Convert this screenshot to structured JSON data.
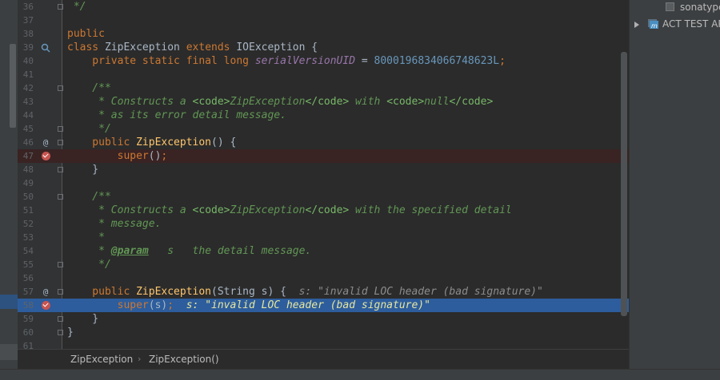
{
  "editor": {
    "lines": [
      {
        "n": "36",
        "tokens": [
          {
            "c": "cm",
            "t": " */"
          }
        ]
      },
      {
        "n": "37",
        "tokens": []
      },
      {
        "n": "38",
        "tokens": [
          {
            "c": "kw",
            "t": "public"
          }
        ]
      },
      {
        "n": "39",
        "tokens": [
          {
            "c": "kw",
            "t": "class "
          },
          {
            "c": "",
            "t": "ZipException "
          },
          {
            "c": "kw",
            "t": "extends "
          },
          {
            "c": "",
            "t": "IOException {"
          }
        ],
        "icon": "implements-icon"
      },
      {
        "n": "40",
        "tokens": [
          {
            "c": "kw",
            "t": "    private static final long "
          },
          {
            "c": "sf",
            "t": "serialVersionUID"
          },
          {
            "c": "",
            "t": " = "
          },
          {
            "c": "num",
            "t": "8000196834066748623L"
          },
          {
            "c": "kw",
            "t": ";"
          }
        ]
      },
      {
        "n": "41",
        "tokens": []
      },
      {
        "n": "42",
        "tokens": [
          {
            "c": "cm",
            "t": "    /**"
          }
        ]
      },
      {
        "n": "43",
        "tokens": [
          {
            "c": "cm",
            "t": "     * Constructs a "
          },
          {
            "c": "tag",
            "t": "<code>"
          },
          {
            "c": "cm",
            "t": "ZipException"
          },
          {
            "c": "tag",
            "t": "</code>"
          },
          {
            "c": "cm",
            "t": " with "
          },
          {
            "c": "tag",
            "t": "<code>"
          },
          {
            "c": "cm",
            "t": "null"
          },
          {
            "c": "tag",
            "t": "</code>"
          }
        ]
      },
      {
        "n": "44",
        "tokens": [
          {
            "c": "cm",
            "t": "     * as its error detail message."
          }
        ]
      },
      {
        "n": "45",
        "tokens": [
          {
            "c": "cm",
            "t": "     */"
          }
        ]
      },
      {
        "n": "46",
        "tokens": [
          {
            "c": "kw",
            "t": "    public "
          },
          {
            "c": "fn",
            "t": "ZipException"
          },
          {
            "c": "",
            "t": "() {"
          }
        ],
        "icon": "override-at-icon"
      },
      {
        "n": "47",
        "tokens": [
          {
            "c": "kw",
            "t": "        super"
          },
          {
            "c": "",
            "t": "()"
          },
          {
            "c": "kw",
            "t": ";"
          }
        ],
        "bp": true
      },
      {
        "n": "48",
        "tokens": [
          {
            "c": "",
            "t": "    }"
          }
        ]
      },
      {
        "n": "49",
        "tokens": []
      },
      {
        "n": "50",
        "tokens": [
          {
            "c": "cm",
            "t": "    /**"
          }
        ]
      },
      {
        "n": "51",
        "tokens": [
          {
            "c": "cm",
            "t": "     * Constructs a "
          },
          {
            "c": "tag",
            "t": "<code>"
          },
          {
            "c": "cm",
            "t": "ZipException"
          },
          {
            "c": "tag",
            "t": "</code>"
          },
          {
            "c": "cm",
            "t": " with the specified detail"
          }
        ]
      },
      {
        "n": "52",
        "tokens": [
          {
            "c": "cm",
            "t": "     * message."
          }
        ]
      },
      {
        "n": "53",
        "tokens": [
          {
            "c": "cm",
            "t": "     *"
          }
        ]
      },
      {
        "n": "54",
        "tokens": [
          {
            "c": "cm",
            "t": "     * "
          },
          {
            "c": "ptag",
            "t": "@param"
          },
          {
            "c": "cm",
            "t": "   s   the detail message."
          }
        ]
      },
      {
        "n": "55",
        "tokens": [
          {
            "c": "cm",
            "t": "     */"
          }
        ]
      },
      {
        "n": "56",
        "tokens": []
      },
      {
        "n": "57",
        "tokens": [
          {
            "c": "kw",
            "t": "    public "
          },
          {
            "c": "fn",
            "t": "ZipException"
          },
          {
            "c": "",
            "t": "(String s) {  "
          },
          {
            "c": "hint",
            "t": "s: \"invalid LOC header (bad signature)\""
          }
        ],
        "icon": "override-at-icon"
      },
      {
        "n": "58",
        "tokens": [
          {
            "c": "kw",
            "t": "        super"
          },
          {
            "c": "",
            "t": "(s)"
          },
          {
            "c": "kw",
            "t": ";"
          },
          {
            "c": "hint2",
            "t": "  s: \"invalid LOC header (bad signature)\""
          }
        ],
        "bp": true,
        "exec": true
      },
      {
        "n": "59",
        "tokens": [
          {
            "c": "",
            "t": "    }"
          }
        ]
      },
      {
        "n": "60",
        "tokens": [
          {
            "c": "",
            "t": "}"
          }
        ]
      },
      {
        "n": "61",
        "tokens": []
      }
    ],
    "folds": [
      "36",
      "42",
      "45",
      "46",
      "48",
      "50",
      "55",
      "57",
      "59",
      "60"
    ]
  },
  "breadcrumb": {
    "items": [
      "ZipException",
      "ZipException()"
    ],
    "separator": "›"
  },
  "side_panel": {
    "items": [
      {
        "label": "sonatype",
        "kind": "checkbox"
      },
      {
        "label": "ACT TEST AP",
        "kind": "module"
      }
    ]
  },
  "colors": {
    "execution_line": "#2d5d9c",
    "breakpoint": "#c75450",
    "background": "#2b2b2b"
  }
}
